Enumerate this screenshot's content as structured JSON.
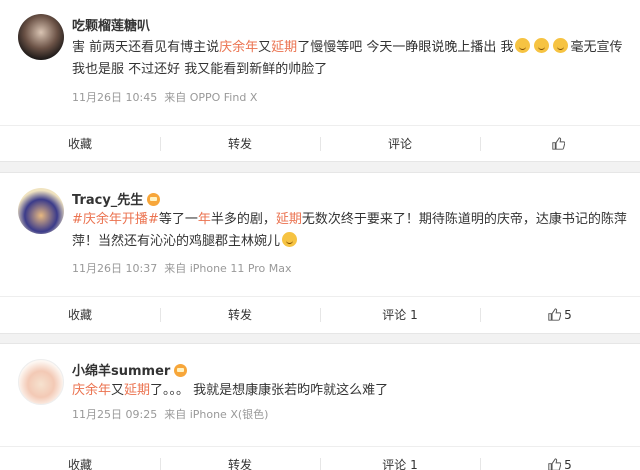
{
  "comments": [
    {
      "user": "吃颗榴莲糖叭",
      "text": [
        {
          "t": "害 前两天还看见有博主说",
          "c": ""
        },
        {
          "t": "庆余年",
          "c": "red"
        },
        {
          "t": "又",
          "c": ""
        },
        {
          "t": "延期",
          "c": "red"
        },
        {
          "t": "了慢慢等吧 今天一睁眼说晚上播出 我",
          "c": ""
        },
        {
          "t": "毫无宣传我也是服  不过还好 我又能看到新鲜的帅脸了",
          "c": ""
        }
      ],
      "time": "11月26日 10:45",
      "source": "来自 OPPO Find X",
      "actions": {
        "collect": "收藏",
        "repost": "转发",
        "comment": "评论",
        "like": ""
      }
    },
    {
      "user": "Tracy_先生",
      "text": [
        {
          "t": "#",
          "c": "link"
        },
        {
          "t": "庆余年",
          "c": "red"
        },
        {
          "t": "开播",
          "c": "link"
        },
        {
          "t": "#",
          "c": "link"
        },
        {
          "t": "等了一",
          "c": ""
        },
        {
          "t": "年",
          "c": "red"
        },
        {
          "t": "半多的剧，",
          "c": ""
        },
        {
          "t": "延期",
          "c": "red"
        },
        {
          "t": "无数次终于要来了！期待陈道明的庆帝，达康书记的陈萍萍！当然还有沁沁的鸡腿郡主林婉儿",
          "c": ""
        }
      ],
      "time": "11月26日 10:37",
      "source": "来自 iPhone 11 Pro Max",
      "actions": {
        "collect": "收藏",
        "repost": "转发",
        "comment": "评论 1",
        "like": "5"
      }
    },
    {
      "user": "小绵羊summer",
      "text": [
        {
          "t": "庆余年",
          "c": "red"
        },
        {
          "t": "又",
          "c": ""
        },
        {
          "t": "延期",
          "c": "red"
        },
        {
          "t": "了。。。  我就是想康康张若昀咋就这么难了",
          "c": ""
        }
      ],
      "time": "11月25日 09:25",
      "source": "来自 iPhone X(银色)",
      "actions": {
        "collect": "收藏",
        "repost": "转发",
        "comment": "评论 1",
        "like": "5"
      }
    }
  ]
}
